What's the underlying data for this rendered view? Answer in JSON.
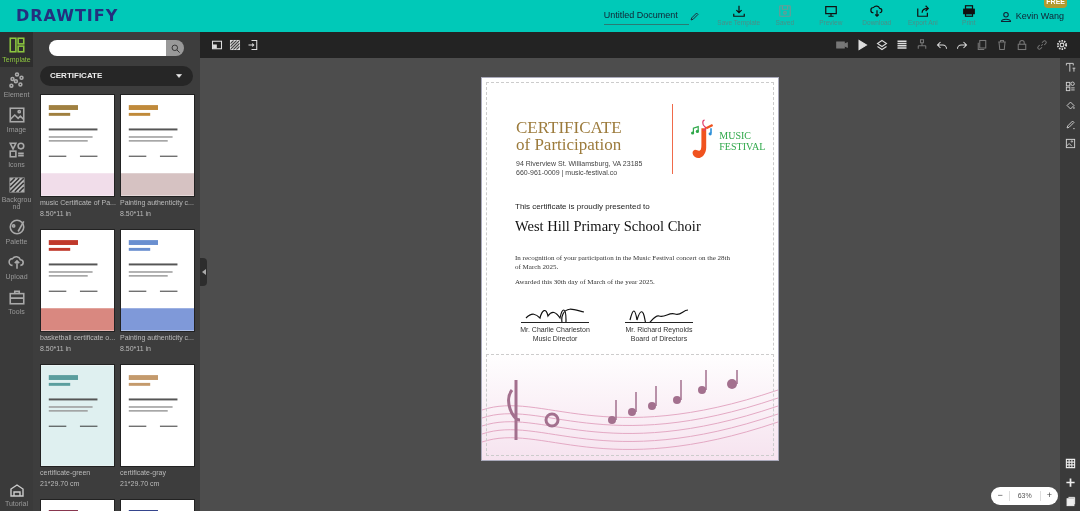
{
  "header": {
    "logo": "DRAWTIFY",
    "document_title": "Untitled Document",
    "actions": [
      {
        "kind": "save-template",
        "label": "Save Template",
        "disabled": false
      },
      {
        "kind": "saved",
        "label": "Saved",
        "disabled": true
      },
      {
        "kind": "preview",
        "label": "Preview",
        "disabled": false
      },
      {
        "kind": "download",
        "label": "Download",
        "disabled": false
      },
      {
        "kind": "export",
        "label": "Export Ani",
        "disabled": false
      },
      {
        "kind": "print",
        "label": "Print",
        "disabled": false
      }
    ],
    "user": {
      "name": "Kevin Wang",
      "badge": "FREE"
    }
  },
  "rail": {
    "items": [
      {
        "kind": "template",
        "label": "Template",
        "selected": true
      },
      {
        "kind": "element",
        "label": "Element",
        "selected": false
      },
      {
        "kind": "image",
        "label": "Image",
        "selected": false
      },
      {
        "kind": "icons",
        "label": "Icons",
        "selected": false
      },
      {
        "kind": "background",
        "label": "Background",
        "selected": false
      },
      {
        "kind": "palette",
        "label": "Palette",
        "selected": false
      },
      {
        "kind": "upload",
        "label": "Upload",
        "selected": false
      },
      {
        "kind": "tools",
        "label": "Tools",
        "selected": false
      }
    ],
    "tutorial": "Tutorial"
  },
  "panel": {
    "category": "CERTIFICATE",
    "templates": [
      {
        "name": "music Certificate of Pa...",
        "size": "8.50*11 in",
        "kind": "music"
      },
      {
        "name": "Painting authenticity c...",
        "size": "8.50*11 in",
        "kind": "painting"
      },
      {
        "name": "basketball certificate o...",
        "size": "8.50*11 in",
        "kind": "basketball"
      },
      {
        "name": "Painting authenticity c...",
        "size": "8.50*11 in",
        "kind": "waves"
      },
      {
        "name": "certificate-green",
        "size": "21*29.70 cm",
        "kind": "green"
      },
      {
        "name": "certificate-gray",
        "size": "21*29.70 cm",
        "kind": "gray"
      },
      {
        "kind": "maroon"
      },
      {
        "kind": "navy"
      }
    ]
  },
  "toolbar": {
    "left": [
      {
        "kind": "resize",
        "disabled": false
      },
      {
        "kind": "background",
        "disabled": false
      },
      {
        "kind": "import",
        "disabled": false
      }
    ],
    "right": [
      {
        "kind": "video",
        "disabled": true
      },
      {
        "kind": "play",
        "disabled": false
      },
      {
        "kind": "layers",
        "disabled": false
      },
      {
        "kind": "rows",
        "disabled": false
      },
      {
        "kind": "group",
        "disabled": true
      },
      {
        "kind": "undo",
        "disabled": false
      },
      {
        "kind": "redo",
        "disabled": false
      },
      {
        "kind": "copy",
        "disabled": true
      },
      {
        "kind": "delete",
        "disabled": true
      },
      {
        "kind": "lock",
        "disabled": true
      },
      {
        "kind": "link",
        "disabled": true
      },
      {
        "kind": "settings",
        "disabled": false
      }
    ]
  },
  "certificate": {
    "title": "CERTIFICATE",
    "subtitle": "of Participation",
    "address": "94 Riverview St. Williamsburg, VA 23185",
    "contact": "660-961-0009 | music-festival.co",
    "logo_line1": "MUSIC",
    "logo_line2": "FESTIVAL",
    "intro": "This certificate is proudly presented to",
    "recipient": "West Hill Primary School Choir",
    "recognition": "In recognition of your participation in the Music Festival concert on the 28th of March 2025.",
    "awarded": "Awarded this 30th day of March of the year 2025.",
    "signers": [
      {
        "name": "Mr. Charlie Charleston",
        "role": "Music Director"
      },
      {
        "name": "Mr. Richard Reynolds",
        "role": "Board of Directors"
      }
    ]
  },
  "side_tools": [
    {
      "kind": "text"
    },
    {
      "kind": "shapes"
    },
    {
      "kind": "fill"
    },
    {
      "kind": "pen"
    },
    {
      "kind": "picture"
    }
  ],
  "bottom_tools": [
    {
      "kind": "grid"
    },
    {
      "kind": "add"
    },
    {
      "kind": "pages"
    }
  ],
  "zoom": {
    "minus": "−",
    "value": "63%",
    "plus": "+"
  }
}
